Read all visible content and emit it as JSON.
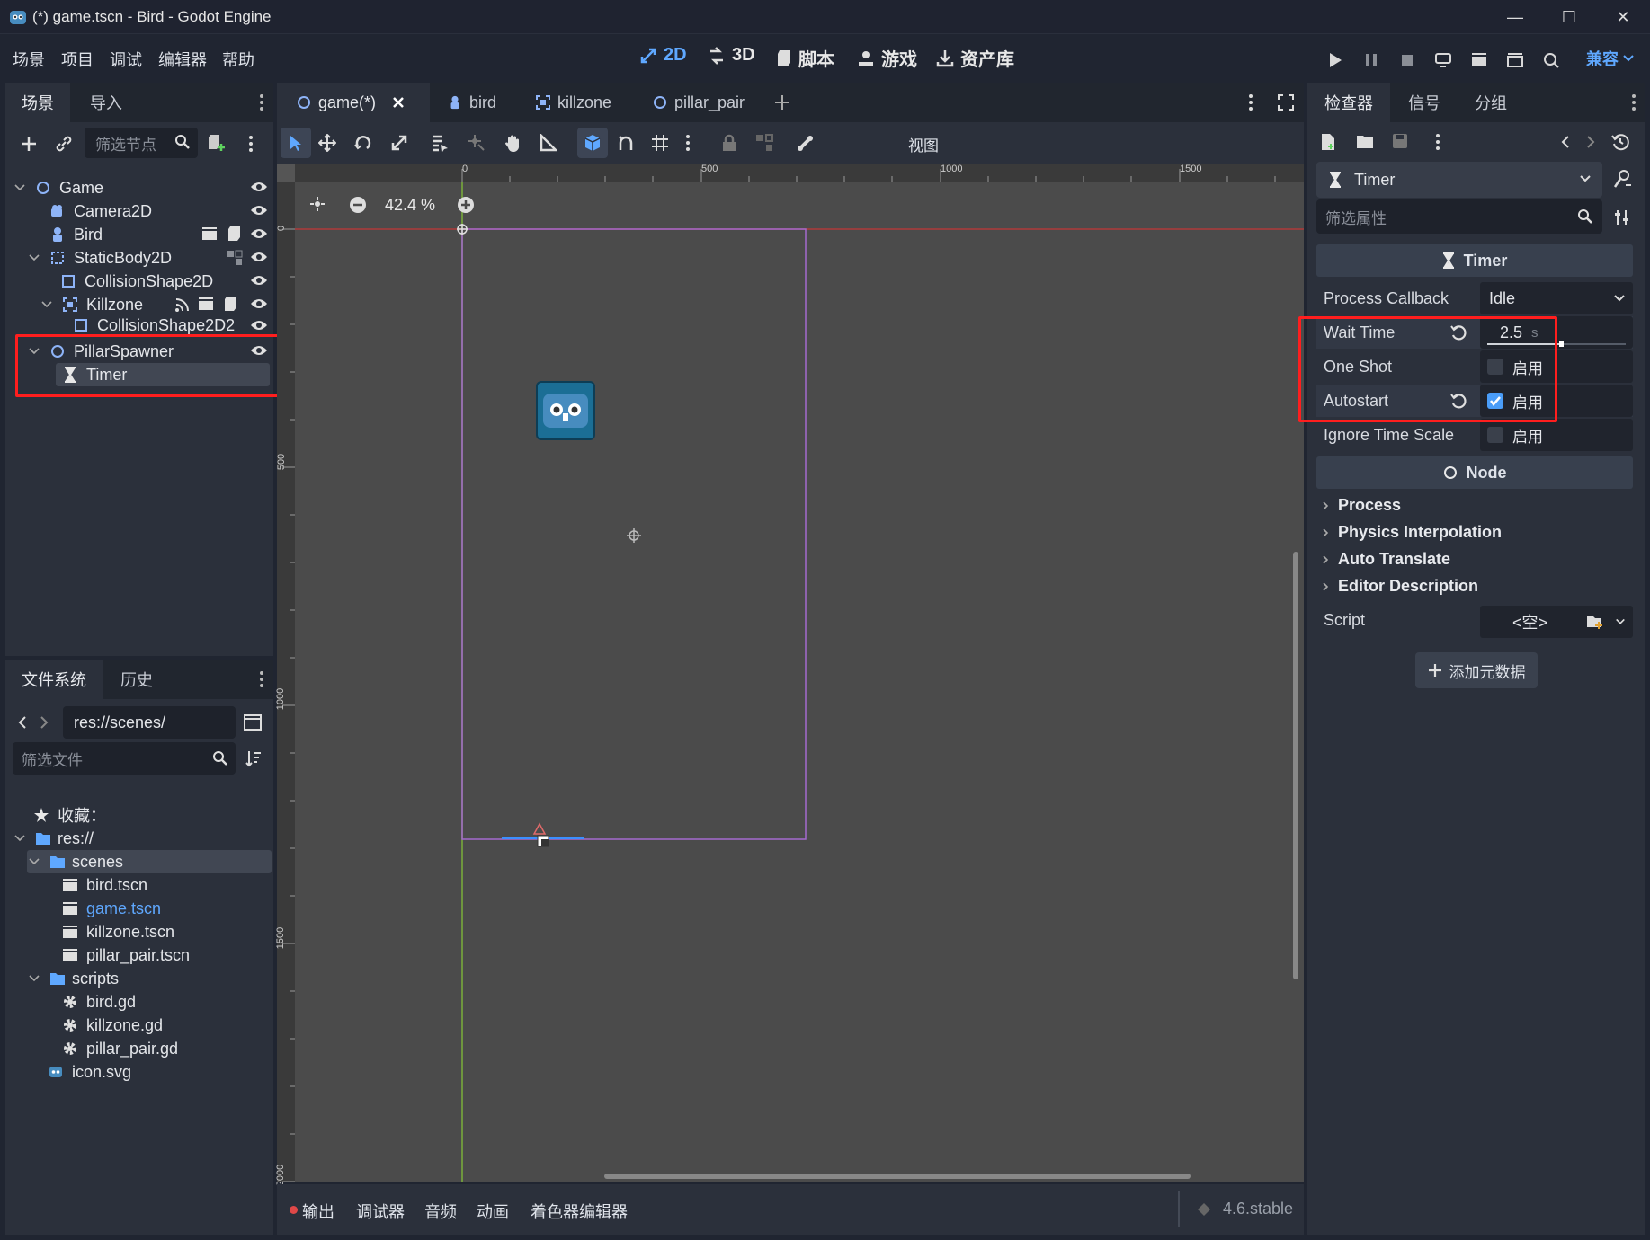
{
  "window": {
    "title": "(*) game.tscn - Bird - Godot Engine",
    "minimize": "—",
    "maximize": "☐",
    "close": "✕"
  },
  "menu": {
    "items": [
      "场景",
      "项目",
      "调试",
      "编辑器",
      "帮助"
    ],
    "workspaces": [
      "2D",
      "3D",
      "脚本",
      "游戏",
      "资产库"
    ],
    "renderer": "兼容"
  },
  "scene_dock": {
    "tabs": [
      "场景",
      "导入"
    ],
    "filter_placeholder": "筛选节点",
    "tree": [
      {
        "label": "Game",
        "indent": 0
      },
      {
        "label": "Camera2D",
        "indent": 1
      },
      {
        "label": "Bird",
        "indent": 1
      },
      {
        "label": "StaticBody2D",
        "indent": 1
      },
      {
        "label": "CollisionShape2D",
        "indent": 2
      },
      {
        "label": "Killzone",
        "indent": 2
      },
      {
        "label": "CollisionShape2D2",
        "indent": 3
      },
      {
        "label": "PillarSpawner",
        "indent": 1
      },
      {
        "label": "Timer",
        "indent": 2
      }
    ]
  },
  "filesystem_dock": {
    "tabs": [
      "文件系统",
      "历史"
    ],
    "path": "res://scenes/",
    "filter_placeholder": "筛选文件",
    "favorites": "收藏：",
    "items": [
      {
        "label": "res://",
        "indent": 0
      },
      {
        "label": "scenes",
        "indent": 1
      },
      {
        "label": "bird.tscn",
        "indent": 2
      },
      {
        "label": "game.tscn",
        "indent": 2
      },
      {
        "label": "killzone.tscn",
        "indent": 2
      },
      {
        "label": "pillar_pair.tscn",
        "indent": 2
      },
      {
        "label": "scripts",
        "indent": 1
      },
      {
        "label": "bird.gd",
        "indent": 2
      },
      {
        "label": "killzone.gd",
        "indent": 2
      },
      {
        "label": "pillar_pair.gd",
        "indent": 2
      },
      {
        "label": "icon.svg",
        "indent": 1
      }
    ]
  },
  "editor_tabs": [
    "game(*)",
    "bird",
    "killzone",
    "pillar_pair"
  ],
  "toolbar": {
    "view_label": "视图"
  },
  "viewport": {
    "zoom": "42.4 %",
    "ruler_top": [
      "0",
      "500",
      "1000",
      "1500"
    ],
    "ruler_left": [
      "0",
      "500",
      "1000",
      "1500",
      "2000"
    ]
  },
  "bottom_panel": {
    "tabs": [
      "输出",
      "调试器",
      "音频",
      "动画",
      "着色器编辑器"
    ],
    "version": "4.6.stable"
  },
  "inspector": {
    "tabs": [
      "检查器",
      "信号",
      "分组"
    ],
    "node_selector": "Timer",
    "filter_placeholder": "筛选属性",
    "class_header": "Timer",
    "properties": {
      "process_callback": {
        "label": "Process Callback",
        "value": "Idle"
      },
      "wait_time": {
        "label": "Wait Time",
        "value": "2.5",
        "unit": "s"
      },
      "one_shot": {
        "label": "One Shot",
        "value": "启用"
      },
      "autostart": {
        "label": "Autostart",
        "value": "启用"
      },
      "ignore_time_scale": {
        "label": "Ignore Time Scale",
        "value": "启用"
      }
    },
    "node_header": "Node",
    "sections": [
      "Process",
      "Physics Interpolation",
      "Auto Translate",
      "Editor Description"
    ],
    "script": {
      "label": "Script",
      "value": "<空>"
    },
    "add_metadata": "添加元数据"
  },
  "colors": {
    "accent": "#5fa8ff",
    "highlight": "#ff1e1e",
    "selection": "#414753"
  }
}
